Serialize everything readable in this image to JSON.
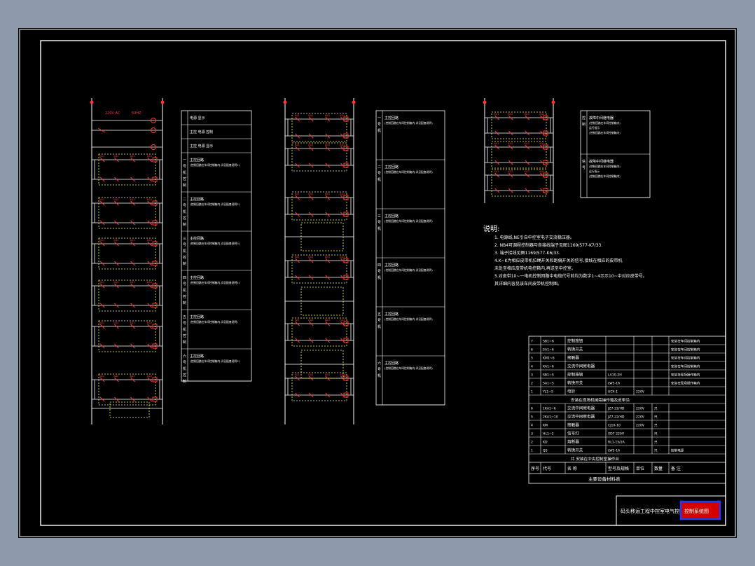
{
  "colors": {
    "background": "#8e9aac",
    "sheet": "#000000",
    "frame": "#ffffff",
    "wire": "#ffffff",
    "component": "#ff3333",
    "dashed_box": "#ffff33",
    "stamp_fill": "#d40000",
    "stamp_border": "#1e3cff"
  },
  "circuit_left": {
    "supply_voltage": "220V AC",
    "supply_freq": "50HZ",
    "power_rows": [
      "电源 显示",
      "主控 电源 控制",
      "主控 电源 显示"
    ],
    "sections": [
      {
        "label": "一号机控制",
        "lines": [
          "主控回路",
          "(控制回路在车间控制箱内,详见配套说明1)"
        ]
      },
      {
        "label": "二号机控制",
        "lines": [
          "主控回路",
          "(控制回路在车间控制箱内,详见配套说明2)"
        ]
      },
      {
        "label": "三号机控制",
        "lines": [
          "主控回路",
          "(控制回路在车间控制箱内,详见配套说明3)"
        ]
      },
      {
        "label": "四号机控制",
        "lines": [
          "主控回路",
          "(控制回路在车间控制箱内,详见配套说明4)"
        ]
      },
      {
        "label": "五号机控制",
        "lines": [
          "主控回路",
          "(控制回路在车间控制箱内,详见配套说明)"
        ]
      },
      {
        "label": "六号机控制",
        "lines": [
          "主控回路",
          "(控制回路在车间控制箱内,详见配套说明2)"
        ]
      }
    ]
  },
  "circuit_mid": {
    "sections": [
      {
        "label": "一号机",
        "lines": [
          "主控回路",
          "(控制回路在车间控制箱内,详见配套说明)"
        ]
      },
      {
        "label": "二号机",
        "lines": [
          "主控回路",
          "(控制回路在车间控制箱内,详见配套说明)"
        ]
      },
      {
        "label": "三号机",
        "lines": [
          "主控回路",
          "(控制回路在车间控制箱内,详见配套说明)"
        ]
      },
      {
        "label": "四号机",
        "lines": [
          "主控回路",
          "(控制回路在车间控制箱内,详见配套说明)"
        ]
      },
      {
        "label": "五号机",
        "lines": [
          "主控回路",
          "(控制回路在车间控制箱内,详见配套说明)"
        ]
      },
      {
        "label": "六号机",
        "lines": [
          "主控回路",
          "(控制回路在车间控制箱内,详见配套说明)"
        ]
      }
    ]
  },
  "circuit_right": {
    "sections": [
      {
        "label": "控制",
        "lines": [
          "故障中间继电器",
          "(控制回路在车间控制箱内)",
          "运行指示",
          "(控制回路在车间控制箱内)"
        ]
      },
      {
        "label": "信号",
        "lines": [
          "故障中间继电器",
          "(控制回路在车间控制箱内)",
          "运行指示",
          "(控制回路在车间控制箱内)"
        ]
      }
    ]
  },
  "notes": {
    "heading": "说明:",
    "lines": [
      "1. 电源线,NE引自中控室电子交流稳压器。",
      "2. NB4可调程控制器与各接线端子见图1169/577-K7/33.",
      "3. 端子接线见图1169/577-K6/33.",
      "4.K~K为相应皮带机拉绳开关和跑偏开关的信号,接线在相应的皮带机",
      "  未处至相应皮带机电控箱内,再送至中控室。",
      "5.对皮带10~一电机控制回路中电缆代号前均为数字1~4示示10~中对应皮带号。",
      "  其详细内容见该车间皮带机控制图。"
    ]
  },
  "bom_upper": {
    "rows": [
      {
        "no": "7",
        "code": "SB1~6",
        "name": "控制按钮",
        "spec": "",
        "unit": "",
        "qty": "",
        "note": "安装在车间控制箱内"
      },
      {
        "no": "6",
        "code": "SA1~6",
        "name": "转换开关",
        "spec": "",
        "unit": "",
        "qty": "",
        "note": "安装在车间控制箱内"
      },
      {
        "no": "5",
        "code": "KM1~6",
        "name": "接触器",
        "spec": "",
        "unit": "",
        "qty": "",
        "note": "安装在车间控制箱内"
      },
      {
        "no": "4",
        "code": "KA1~6",
        "name": "交流中间继电器",
        "spec": "",
        "unit": "",
        "qty": "",
        "note": "安装在车间控制箱内"
      },
      {
        "no": "3",
        "code": "SB1~5",
        "name": "控制按钮",
        "spec": "LA10-2H",
        "unit": "",
        "qty": "",
        "note": "安装在现场操作箱内"
      },
      {
        "no": "2",
        "code": "SA1~5",
        "name": "转换开关",
        "spec": "LW5-16",
        "unit": "",
        "qty": "",
        "note": "安装在现场操作箱内"
      },
      {
        "no": "1",
        "code": "YL1~5",
        "name": "电铃",
        "spec": "UC4-1",
        "unit": "220V",
        "qty": "",
        "note": ""
      }
    ],
    "caption": "安装在现场机械旁操作箱及皮带沿"
  },
  "bom_lower": {
    "rows": [
      {
        "no": "6",
        "code": "1KA1~6",
        "name": "交流中间继电器",
        "spec": "JZ7-22/HD",
        "unit": "220V",
        "qty": "只",
        "note": ""
      },
      {
        "no": "5",
        "code": "2KA1~10",
        "name": "交流中间继电器",
        "spec": "JZ7-22/HD",
        "unit": "220V",
        "qty": "只",
        "note": ""
      },
      {
        "no": "4",
        "code": "KM",
        "name": "接触器",
        "spec": "CJ10-10",
        "unit": "220V",
        "qty": "只",
        "note": ""
      },
      {
        "no": "3",
        "code": "HL1~2",
        "name": "信号灯",
        "spec": "XD7 220V",
        "unit": "",
        "qty": "只",
        "note": ""
      },
      {
        "no": "2",
        "code": "KD",
        "name": "熔断器",
        "spec": "RL1-15/2A",
        "unit": "",
        "qty": "只",
        "note": ""
      },
      {
        "no": "1",
        "code": "QS",
        "name": "转换开关",
        "spec": "LW5-16",
        "unit": "",
        "qty": "只",
        "note": "控制电源"
      }
    ],
    "caption": "共  安装在中央控制室操作台"
  },
  "bom_header": {
    "no": "序号",
    "code": "代号",
    "name": "名  称",
    "spec": "型号及规格",
    "unit": "单位",
    "qty": "数量",
    "note": "备  注"
  },
  "bom_title": "主要设备材料表",
  "title_block": {
    "title": "码头移运工程中控室电气控制系统图",
    "stamp": "控制系统图"
  }
}
